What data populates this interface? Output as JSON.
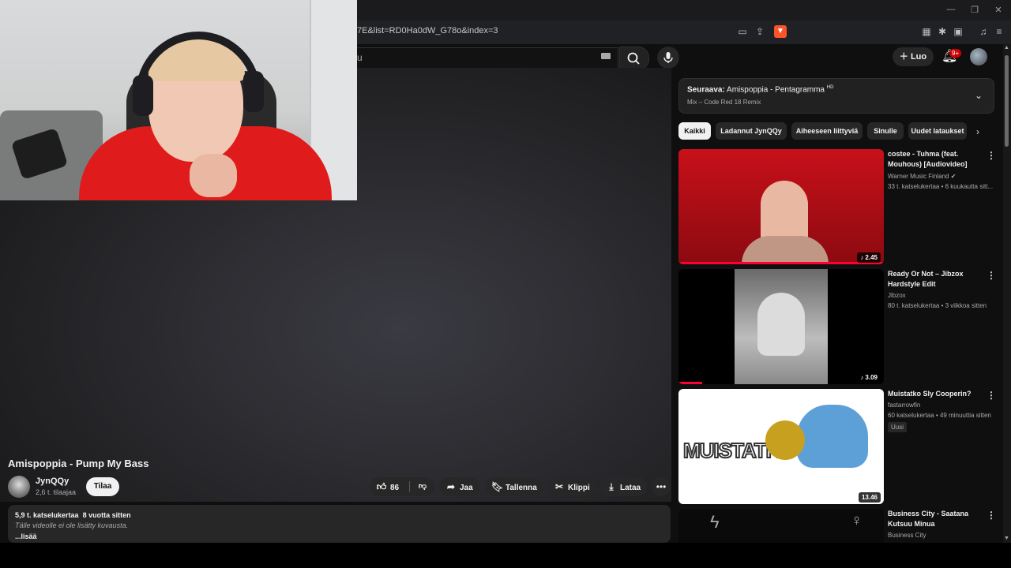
{
  "browser": {
    "url": "7E&list=RD0Ha0dW_G78o&index=3"
  },
  "header": {
    "search_text": "u",
    "create_label": "Luo",
    "notifications_badge": "9+"
  },
  "video": {
    "title": "Amispoppia - Pump My Bass",
    "channel": "JynQQy",
    "subscribers": "2,6 t. tilaajaa",
    "subscribe_label": "Tilaa",
    "likes": "86",
    "share_label": "Jaa",
    "save_label": "Tallenna",
    "clip_label": "Klippi",
    "download_label": "Lataa",
    "description": {
      "views": "5,9 t. katselukertaa",
      "age": "8 vuotta sitten",
      "text": "Tälle videolle ei ole lisätty kuvausta.",
      "more": "...lisää"
    }
  },
  "mix": {
    "next_prefix": "Seuraava:",
    "next_title": "Amispoppia - Pentagramma",
    "hd": "HD",
    "subtitle": "Mix – Code Red 18 Remix"
  },
  "chips": [
    "Kaikki",
    "Ladannut JynQQy",
    "Aiheeseen liittyviä",
    "Sinulle",
    "Uudet lataukset"
  ],
  "related": [
    {
      "title": "costee - Tuhma (feat. Mouhous) [Audiovideo]",
      "channel": "Warner Music Finland",
      "verified": "✔",
      "meta": "33 t. katselukertaa • 6 kuukautta sitt...",
      "duration": "♪ 2.45"
    },
    {
      "title": "Ready Or Not – Jibzox Hardstyle Edit",
      "channel": "Jibzox",
      "meta": "80 t. katselukertaa • 3 viikkoa sitten",
      "duration": "♪ 3.09"
    },
    {
      "title": "Muistatko Sly Cooperin?",
      "channel": "fastarrowfin",
      "meta": "60 katselukertaa • 49 minuuttia sitten",
      "badge": "Uusi",
      "duration": "13.46",
      "thumb_text": "MUISTATKO?"
    },
    {
      "title": "Business City - Saatana Kutsuu Minua",
      "channel": "Business City"
    }
  ],
  "colors": {
    "accent": "#cc0000",
    "background": "#0f0f0f",
    "shirt": "#e01b1b"
  }
}
